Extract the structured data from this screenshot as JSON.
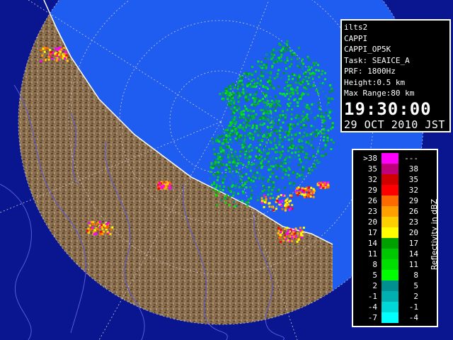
{
  "info": {
    "lines": [
      "ilts2",
      "CAPPI",
      "CAPPI_OP5K",
      "Task: SEAICE_A",
      "PRF: 1800Hz",
      "Height:0.5 km",
      "Max Range:80 km"
    ],
    "time": "19:30:00",
    "date": "29 OCT 2010 JST"
  },
  "legend": {
    "title": "Reflectivity in dBZ",
    "rows": [
      {
        "lo": ">38",
        "hi": "---",
        "color": "#ff00ff"
      },
      {
        "lo": "35",
        "hi": "38",
        "color": "#c0007a"
      },
      {
        "lo": "32",
        "hi": "35",
        "color": "#d00000"
      },
      {
        "lo": "29",
        "hi": "32",
        "color": "#ff0000"
      },
      {
        "lo": "26",
        "hi": "29",
        "color": "#ff6a00"
      },
      {
        "lo": "23",
        "hi": "26",
        "color": "#ffa000"
      },
      {
        "lo": "20",
        "hi": "23",
        "color": "#ffd000"
      },
      {
        "lo": "17",
        "hi": "20",
        "color": "#ffff00"
      },
      {
        "lo": "14",
        "hi": "17",
        "color": "#00a000"
      },
      {
        "lo": "11",
        "hi": "14",
        "color": "#00c800"
      },
      {
        "lo": "8",
        "hi": "11",
        "color": "#00e000"
      },
      {
        "lo": "5",
        "hi": "8",
        "color": "#00ff00"
      },
      {
        "lo": "2",
        "hi": "5",
        "color": "#009090"
      },
      {
        "lo": "-1",
        "hi": "2",
        "color": "#00b0b0"
      },
      {
        "lo": "-4",
        "hi": "-1",
        "color": "#00d8d8"
      },
      {
        "lo": "-7",
        "hi": "-4",
        "color": "#00ffff"
      }
    ]
  },
  "colors": {
    "ocean": "#0a1590",
    "radar_range": "#1f5cf0",
    "land": "#8a7050",
    "rivers": "#5a5ad8",
    "range_rings": "#c8c8c8"
  }
}
